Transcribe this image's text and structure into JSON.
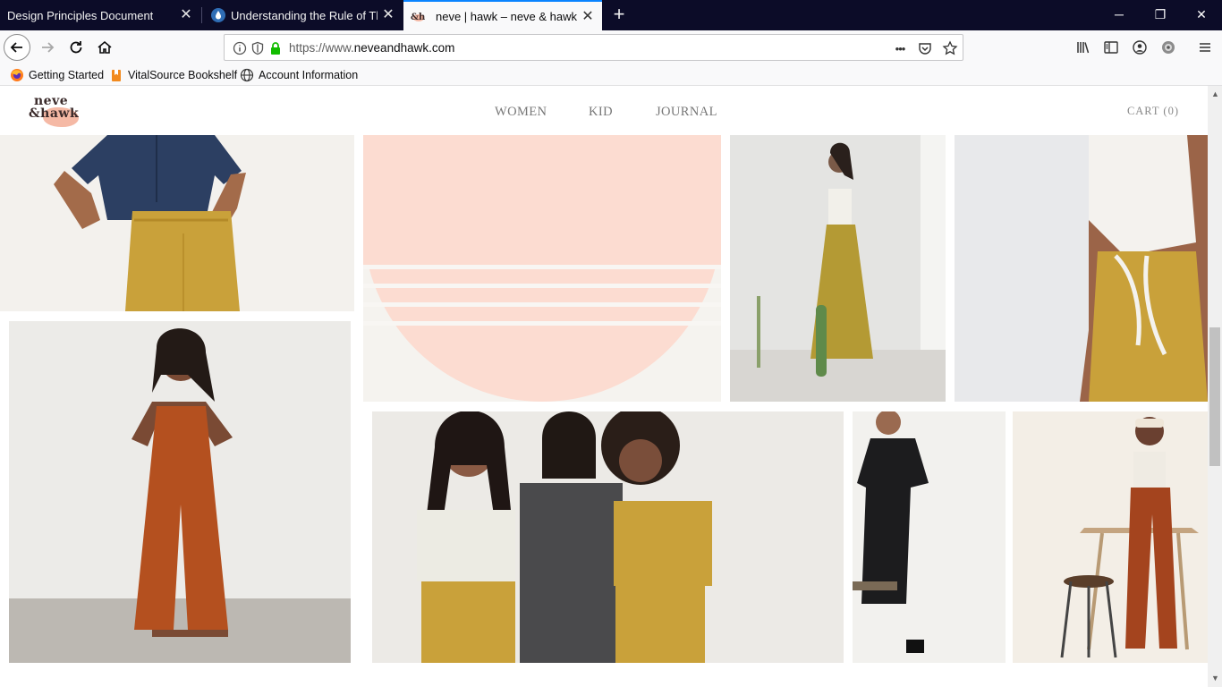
{
  "tabs": [
    {
      "title": "Design Principles Document",
      "favicon": "document-icon",
      "active": false
    },
    {
      "title": "Understanding the Rule of Thir",
      "favicon": "droplet-icon",
      "active": false
    },
    {
      "title": "neve | hawk – neve & hawk",
      "favicon": "neve-hawk-favicon",
      "active": true
    }
  ],
  "tab_close_glyph": "✕",
  "new_tab_glyph": "+",
  "window_controls": {
    "minimize": "─",
    "restore": "❐",
    "close": "✕"
  },
  "address_bar": {
    "url_prefix": "https://www.",
    "url_domain": "neveandhawk.com",
    "more": "•••"
  },
  "bookmarks": [
    {
      "label": "Getting Started",
      "icon": "firefox-icon"
    },
    {
      "label": "VitalSource Bookshelf",
      "icon": "vitalsource-icon"
    },
    {
      "label": "Account Information",
      "icon": "globe-icon"
    }
  ],
  "site": {
    "logo_top": "neve",
    "logo_bottom": "&hawk",
    "menu": [
      "WOMEN",
      "KID",
      "JOURNAL"
    ],
    "cart": "CART (0)"
  },
  "colors": {
    "tabstrip": "#0c0c28",
    "accent": "#0a84ff",
    "peach": "#fcdcd1",
    "mustard": "#c9a13a",
    "rust": "#b4501f",
    "navy": "#2c3f62"
  },
  "gallery": [
    {
      "name": "photo-navy-shirt-mustard-pants"
    },
    {
      "name": "sunset-graphic"
    },
    {
      "name": "photo-woman-by-window-mustard-skirt"
    },
    {
      "name": "photo-back-tie-top-mustard-skirt"
    },
    {
      "name": "photo-rust-jumpsuit"
    },
    {
      "name": "photo-three-women-group"
    },
    {
      "name": "photo-black-dress"
    },
    {
      "name": "photo-rust-pants-stool"
    }
  ]
}
